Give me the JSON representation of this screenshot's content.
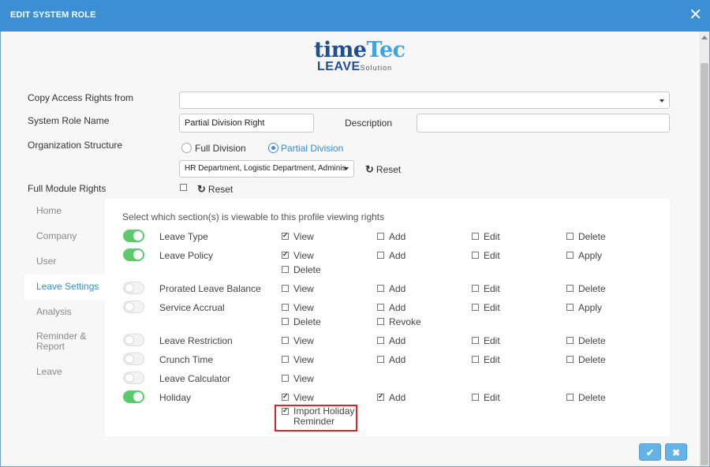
{
  "window": {
    "title": "EDIT SYSTEM ROLE",
    "close_icon": "✕"
  },
  "logo": {
    "top_a": "time",
    "top_b": "Tec",
    "bottom_a": "LEAVE",
    "bottom_b": "Solution"
  },
  "form": {
    "copy_access_label": "Copy Access Rights from",
    "copy_access_value": "",
    "role_name_label": "System Role Name",
    "role_name_value": "Partial Division Right",
    "description_label": "Description",
    "description_value": "",
    "org_label": "Organization Structure",
    "full_division": "Full Division",
    "partial_division": "Partial Division",
    "departments_value": "HR Department, Logistic Department, Adminis",
    "reset": "Reset",
    "full_module_label": "Full Module Rights",
    "full_module_checked": false
  },
  "sidebar": [
    "Home",
    "Company",
    "User",
    "Leave Settings",
    "Analysis",
    "Reminder & Report",
    "Leave"
  ],
  "sidebar_active": "Leave Settings",
  "panel": {
    "heading": "Select which section(s) is viewable to this profile viewing rights",
    "rows": [
      {
        "name": "Leave Type",
        "enabled": true,
        "perms": [
          [
            "View",
            true
          ],
          [
            "Add",
            false
          ],
          [
            "Edit",
            false
          ],
          [
            "Delete",
            false
          ]
        ]
      },
      {
        "name": "Leave Policy",
        "enabled": true,
        "perms": [
          [
            "View",
            true
          ],
          [
            "Add",
            false
          ],
          [
            "Edit",
            false
          ],
          [
            "Apply",
            false
          ],
          [
            "Delete",
            false
          ]
        ]
      },
      {
        "name": "Prorated Leave Balance",
        "enabled": false,
        "perms": [
          [
            "View",
            false
          ],
          [
            "Add",
            false
          ],
          [
            "Edit",
            false
          ],
          [
            "Delete",
            false
          ]
        ]
      },
      {
        "name": "Service Accrual",
        "enabled": false,
        "perms": [
          [
            "View",
            false
          ],
          [
            "Add",
            false
          ],
          [
            "Edit",
            false
          ],
          [
            "Apply",
            false
          ],
          [
            "Delete",
            false
          ],
          [
            "Revoke",
            false
          ]
        ]
      },
      {
        "name": "Leave Restriction",
        "enabled": false,
        "perms": [
          [
            "View",
            false
          ],
          [
            "Add",
            false
          ],
          [
            "Edit",
            false
          ],
          [
            "Delete",
            false
          ]
        ]
      },
      {
        "name": "Crunch Time",
        "enabled": false,
        "perms": [
          [
            "View",
            false
          ],
          [
            "Add",
            false
          ],
          [
            "Edit",
            false
          ],
          [
            "Delete",
            false
          ]
        ]
      },
      {
        "name": "Leave Calculator",
        "enabled": false,
        "perms": [
          [
            "View",
            false
          ]
        ]
      },
      {
        "name": "Holiday",
        "enabled": true,
        "perms": [
          [
            "View",
            true
          ],
          [
            "Add",
            true
          ],
          [
            "Edit",
            false
          ],
          [
            "Delete",
            false
          ],
          [
            "Import Holiday Reminder",
            true
          ]
        ]
      }
    ]
  },
  "footer": {
    "confirm_icon": "✔",
    "cancel_icon": "✖"
  },
  "colors": {
    "titlebar": "#3d8fd4",
    "accent": "#2f8fd8",
    "toggle_on": "#5cc96e",
    "highlight": "#d9232d"
  }
}
